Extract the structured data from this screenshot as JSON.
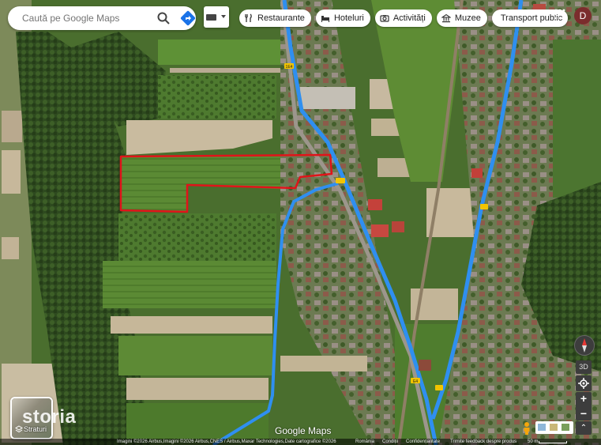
{
  "search": {
    "placeholder": "Caută pe Google Maps"
  },
  "chips": [
    {
      "label": "Restaurante",
      "icon": "fork-knife-icon"
    },
    {
      "label": "Hoteluri",
      "icon": "bed-icon"
    },
    {
      "label": "Activități",
      "icon": "camera-icon"
    },
    {
      "label": "Muzee",
      "icon": "museum-icon"
    },
    {
      "label": "Transport public",
      "icon": "bus-icon"
    }
  ],
  "account": {
    "initial": "D",
    "color": "#7b2d2d"
  },
  "road_labels": [
    "1E4",
    "E4"
  ],
  "layers": {
    "label": "Straturi"
  },
  "watermark": "storia",
  "controls": {
    "btn3d": "3D",
    "zoom_in": "+",
    "zoom_out": "−",
    "expand": "⌃"
  },
  "logo": "Google Maps",
  "footer": {
    "imagery": "Imagini ©2026 Airbus,Imagini ©2026 Airbus,CNES / Airbus,Maxar Technologies,Date cartografice ©2026",
    "country": "România",
    "terms": "Condiții",
    "privacy": "Confidențialitate",
    "feedback": "Trimite feedback despre produs",
    "scale": "50 m"
  },
  "colors": {
    "route": "#2f8ff0",
    "parcel_outline": "#e0141a",
    "field_green": "#4c7a2d",
    "field_dry": "#c8b89a"
  }
}
